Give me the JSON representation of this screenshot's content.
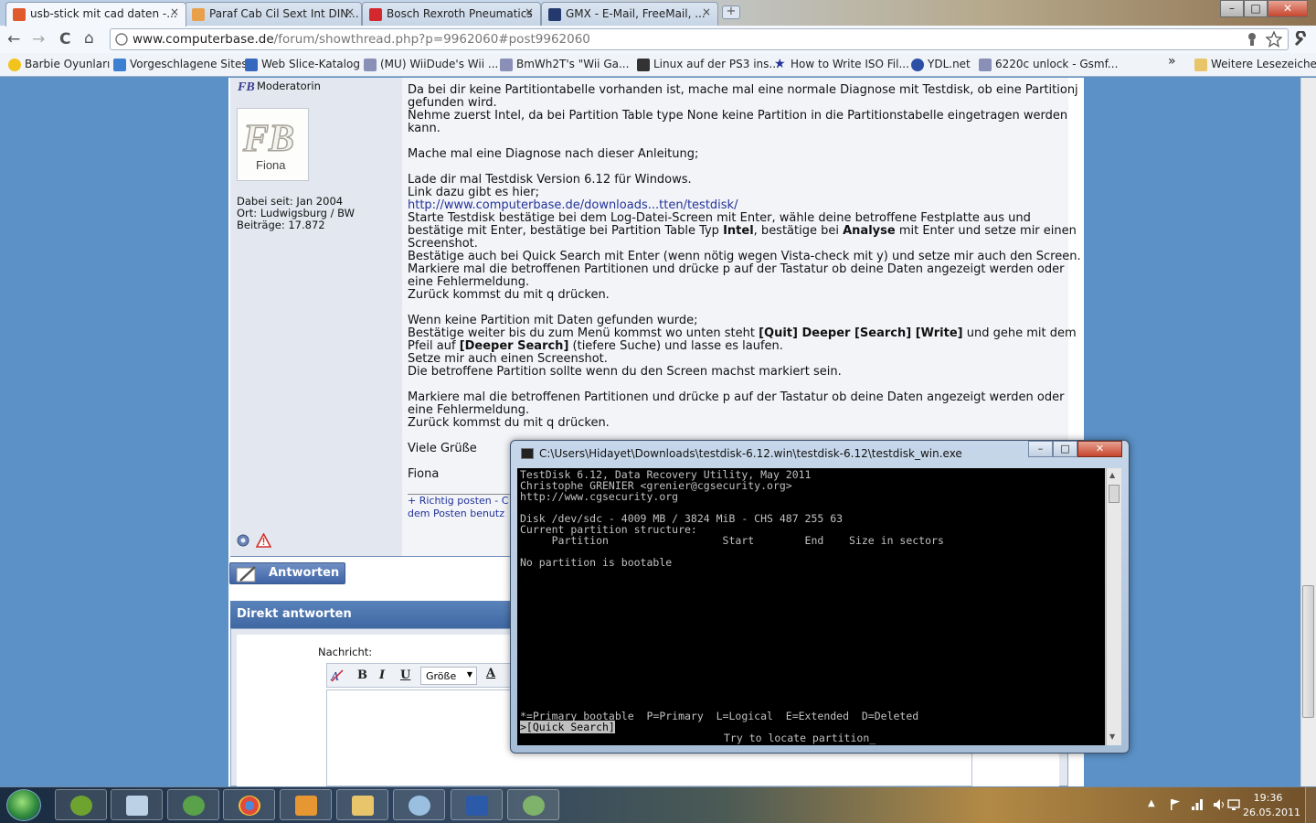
{
  "browser": {
    "tabs": [
      {
        "title": "usb-stick mit cad daten -...",
        "active": true
      },
      {
        "title": "Paraf Cab Cil Sext Int DIN...",
        "active": false
      },
      {
        "title": "Bosch Rexroth Pneumatics",
        "active": false
      },
      {
        "title": "GMX - E-Mail, FreeMail, ...",
        "active": false
      }
    ],
    "new_tab": "+",
    "tab_close": "×",
    "window_controls": {
      "minimize": "–",
      "maximize": "□",
      "close": "✕"
    },
    "nav": {
      "back": "←",
      "forward": "→",
      "reload": "C",
      "home": "⌂"
    },
    "url": {
      "host": "www.computerbase.de",
      "path": "/forum/showthread.php?p=9962060#post9962060"
    },
    "bookmarks": [
      "Barbie Oyunları",
      "Vorgeschlagene Sites",
      "Web Slice-Katalog",
      "(MU) WiiDude's Wii ...",
      "BmWh2T's \"Wii Ga...",
      "Linux auf der PS3 ins...",
      "How to Write ISO Fil...",
      "YDL.net",
      "6220c unlock - Gsmf..."
    ],
    "bookmarks_more": "»",
    "other_bookmarks": "Weitere Lesezeichen"
  },
  "user": {
    "role": "Moderatorin",
    "avatar_text": "FB",
    "avatar_caption": "Fiona",
    "dabei_seit": "Dabei seit: Jan 2004",
    "ort": "Ort: Ludwigsburg / BW",
    "beitraege": "Beiträge: 17.872"
  },
  "post": {
    "lines": [
      "Da bei dir keine Partitiontabelle vorhanden ist, mache mal eine normale Diagnose mit Testdisk, ob eine Partitionj",
      "gefunden wird.",
      "Nehme zuerst Intel, da bei Partition Table type None keine Partition in die Partitionstabelle eingetragen werden",
      "kann.",
      "",
      "Mache mal eine Diagnose nach dieser Anleitung;",
      "",
      "Lade dir mal Testdisk Version 6.12 für Windows.",
      "Link dazu gibt es hier;"
    ],
    "link": "http://www.computerbase.de/downloads...tten/testdisk/",
    "l_starte1": "Starte Testdisk bestätige bei dem Log-Datei-Screen mit Enter, wähle deine betroffene Festplatte aus und",
    "l_starte2a": "bestätige mit Enter, bestätige bei Partition Table Typ ",
    "l_starte2b": "Intel",
    "l_starte2c": ", bestätige bei ",
    "l_starte2d": "Analyse",
    "l_starte2e": " mit Enter und setze mir einen",
    "l_screenshot": "Screenshot.",
    "l_quick": "Bestätige auch bei Quick Search mit Enter (wenn nötig wegen Vista-check mit y) und setze mir auch den Screen.",
    "l_mark1": "Markiere mal die betroffenen Partitionen und drücke p auf der Tastatur ob deine Daten angezeigt werden oder",
    "l_mark2": "eine Fehlermeldung.",
    "l_zurueck": "Zurück kommst du mit q drücken.",
    "l_wenn": "Wenn keine Partition mit Daten gefunden wurde;",
    "l_best_a": "Bestätige weiter bis du zum Menü kommst wo unten steht ",
    "l_best_b": "[Quit] Deeper [Search] [Write]",
    "l_best_c": " und gehe mit dem",
    "l_pfeil_a": "Pfeil auf ",
    "l_pfeil_b": "[Deeper Search]",
    "l_pfeil_c": " (tiefere Suche) und lasse es laufen.",
    "l_setze": "Setze mir auch einen Screenshot.",
    "l_betroffene": "Die betroffene Partition sollte wenn du den Screen machst markiert sein.",
    "l_mark3": "Markiere mal die betroffenen Partitionen und drücke p auf der Tastatur ob deine Daten angezeigt werden oder",
    "l_mark4": "eine Fehlermeldung.",
    "l_zurueck2": "Zurück kommst du mit q drücken.",
    "greeting": "Viele Grüße",
    "signature": "Fiona",
    "sig_link1": "+ Richtig posten - C",
    "sig_link2": "dem Posten benutz"
  },
  "reply": {
    "antworten": "Antworten",
    "direkt": "Direkt antworten",
    "nachricht_label": "Nachricht:",
    "bold": "B",
    "italic": "I",
    "underline": "U",
    "size_label": "Größe",
    "font_color": "A"
  },
  "cmd": {
    "title": "C:\\Users\\Hidayet\\Downloads\\testdisk-6.12.win\\testdisk-6.12\\testdisk_win.exe",
    "lines": [
      "TestDisk 6.12, Data Recovery Utility, May 2011",
      "Christophe GRENIER <grenier@cgsecurity.org>",
      "http://www.cgsecurity.org",
      "",
      "Disk /dev/sdc - 4009 MB / 3824 MiB - CHS 487 255 63",
      "Current partition structure:",
      "     Partition                  Start        End    Size in sectors",
      "",
      "No partition is bootable"
    ],
    "legend": "*=Primary bootable  P=Primary  L=Logical  E=Extended  D=Deleted",
    "selected": ">[Quick Search]",
    "prompt": "Try to locate partition",
    "cursor": "_"
  },
  "taskbar": {
    "clock_time": "19:36",
    "clock_date": "26.05.2011"
  },
  "colors": {
    "desktop": "#5b91c7",
    "console_bg": "#000000",
    "console_fg": "#c0c0c0",
    "link": "#23329a"
  }
}
